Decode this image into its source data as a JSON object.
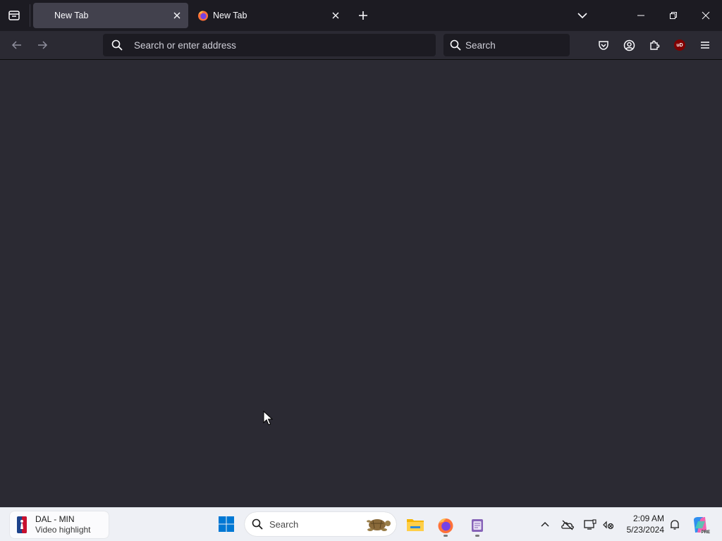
{
  "browser": {
    "tabs": [
      {
        "label": "New Tab",
        "active": true
      },
      {
        "label": "New Tab",
        "active": false
      }
    ],
    "urlbar": {
      "placeholder": "Search or enter address"
    },
    "searchbar": {
      "placeholder": "Search"
    },
    "extension_badge": "uD"
  },
  "taskbar": {
    "widget": {
      "title": "DAL - MIN",
      "subtitle": "Video highlight"
    },
    "search": {
      "placeholder": "Search"
    },
    "clock": {
      "time": "2:09 AM",
      "date": "5/23/2024"
    },
    "copilot_badge": "PRE"
  },
  "colors": {
    "tabbar_bg": "#1c1b22",
    "toolbar_bg": "#2b2a33",
    "content_bg": "#2b2a33",
    "active_tab_bg": "#42414d",
    "taskbar_bg": "#eef0f5",
    "accent_blue": "#0078d4",
    "extension_red": "#800000"
  },
  "icons": [
    "firefox-view-icon",
    "firefox-logo-icon",
    "close-icon",
    "plus-icon",
    "chevron-down-icon",
    "minimize-icon",
    "restore-icon",
    "back-icon",
    "forward-icon",
    "search-icon",
    "pocket-icon",
    "account-icon",
    "extensions-icon",
    "ublock-icon",
    "menu-icon",
    "nba-logo-icon",
    "windows-start-icon",
    "turtle-icon",
    "file-explorer-icon",
    "notepad-icon",
    "chevron-up-icon",
    "onedrive-icon",
    "display-icon",
    "network-icon",
    "bell-icon",
    "copilot-icon"
  ]
}
